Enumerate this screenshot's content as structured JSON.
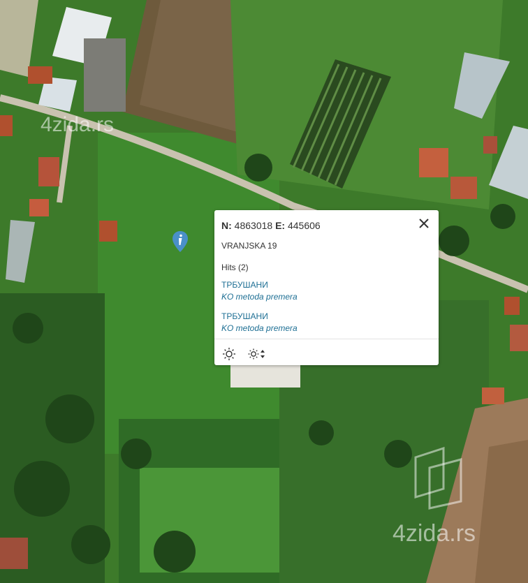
{
  "map": {
    "popup": {
      "n_label": "N:",
      "n_value": "4863018",
      "e_label": "E:",
      "e_value": "445606",
      "address": "VRANJSKA 19",
      "hits_label": "Hits (2)",
      "hits": [
        {
          "title": "ТРБУШАНИ",
          "subtitle": "KO metoda premera"
        },
        {
          "title": "ТРБУШАНИ",
          "subtitle": "KO metoda premera"
        }
      ],
      "tools": [
        "sun-brightness-icon",
        "sun-adjust-icon"
      ],
      "link_color": "#1e6f94"
    },
    "marker_icon": "info-marker-icon",
    "marker_color": "#4a90c8",
    "watermark_top": "4zida.rs",
    "watermark_bottom": "4zida.rs"
  }
}
